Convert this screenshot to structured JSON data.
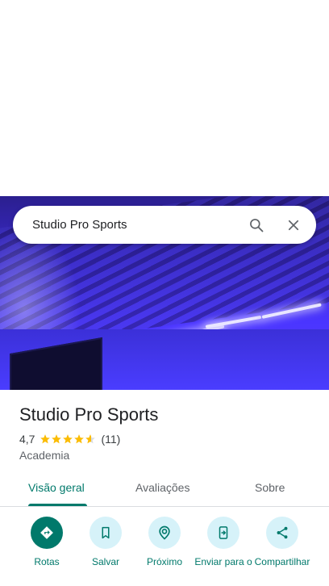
{
  "search": {
    "query": "Studio Pro Sports",
    "search_icon": "search-icon",
    "close_icon": "close-icon"
  },
  "place": {
    "name": "Studio Pro Sports",
    "rating": "4,7",
    "rating_value": 4.7,
    "reviews_count": "(11)",
    "category": "Academia",
    "star_color": "#fbbc04"
  },
  "tabs": [
    {
      "label": "Visão geral",
      "active": true
    },
    {
      "label": "Avaliações",
      "active": false
    },
    {
      "label": "Sobre",
      "active": false
    }
  ],
  "actions": [
    {
      "label": "Rotas",
      "icon": "directions-icon"
    },
    {
      "label": "Salvar",
      "icon": "bookmark-icon"
    },
    {
      "label": "Próximo",
      "icon": "nearby-icon"
    },
    {
      "label": "Enviar para o",
      "icon": "send-to-phone-icon"
    },
    {
      "label": "Compartilhar",
      "icon": "share-icon"
    }
  ],
  "colors": {
    "accent": "#00796b",
    "action_bg": "#d6f2f9"
  }
}
